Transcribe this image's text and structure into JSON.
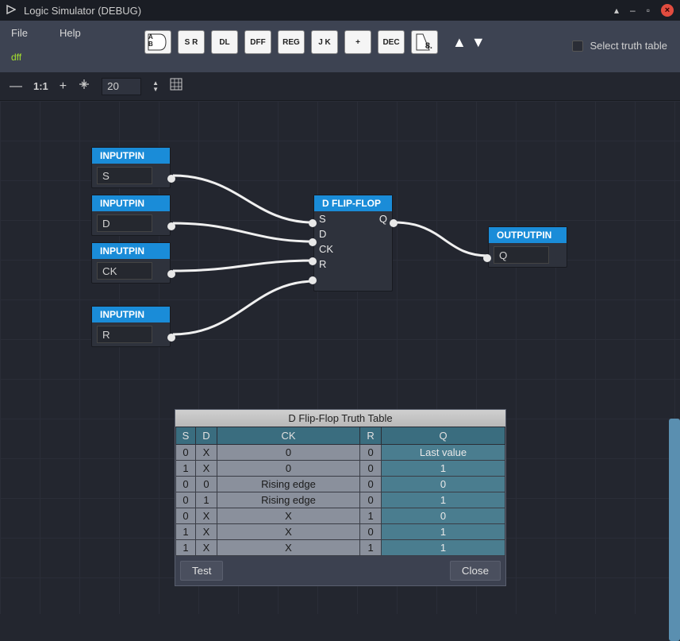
{
  "window": {
    "title": "Logic Simulator (DEBUG)"
  },
  "menu": {
    "file": "File",
    "help": "Help",
    "current_file": "dff",
    "select_truth_table": "Select truth table"
  },
  "palette": {
    "items": [
      "A\nB",
      "S R",
      "DL",
      "DFF",
      "REG",
      "J K",
      "+",
      "DEC",
      "8."
    ]
  },
  "toolbar": {
    "zoom_value": "20"
  },
  "nodes": {
    "inputpin_label": "INPUTPIN",
    "outputpin_label": "OUTPUTPIN",
    "input_s": "S",
    "input_d": "D",
    "input_ck": "CK",
    "input_r": "R",
    "dff_label": "D FLIP-FLOP",
    "dff_pins": {
      "s": "S",
      "d": "D",
      "ck": "CK",
      "r": "R",
      "q": "Q"
    },
    "output_q": "Q"
  },
  "dialog": {
    "title": "D Flip-Flop Truth Table",
    "headers": [
      "S",
      "D",
      "CK",
      "R",
      "Q"
    ],
    "rows": [
      [
        "0",
        "X",
        "0",
        "0",
        "Last value"
      ],
      [
        "1",
        "X",
        "0",
        "0",
        "1"
      ],
      [
        "0",
        "0",
        "Rising edge",
        "0",
        "0"
      ],
      [
        "0",
        "1",
        "Rising edge",
        "0",
        "1"
      ],
      [
        "0",
        "X",
        "X",
        "1",
        "0"
      ],
      [
        "1",
        "X",
        "X",
        "0",
        "1"
      ],
      [
        "1",
        "X",
        "X",
        "1",
        "1"
      ]
    ],
    "test_btn": "Test",
    "close_btn": "Close"
  },
  "chart_data": {
    "type": "table",
    "title": "D Flip-Flop Truth Table",
    "columns": [
      "S",
      "D",
      "CK",
      "R",
      "Q"
    ],
    "rows": [
      [
        "0",
        "X",
        "0",
        "0",
        "Last value"
      ],
      [
        "1",
        "X",
        "0",
        "0",
        "1"
      ],
      [
        "0",
        "0",
        "Rising edge",
        "0",
        "0"
      ],
      [
        "0",
        "1",
        "Rising edge",
        "0",
        "1"
      ],
      [
        "0",
        "X",
        "X",
        "1",
        "0"
      ],
      [
        "1",
        "X",
        "X",
        "0",
        "1"
      ],
      [
        "1",
        "X",
        "X",
        "1",
        "1"
      ]
    ]
  }
}
